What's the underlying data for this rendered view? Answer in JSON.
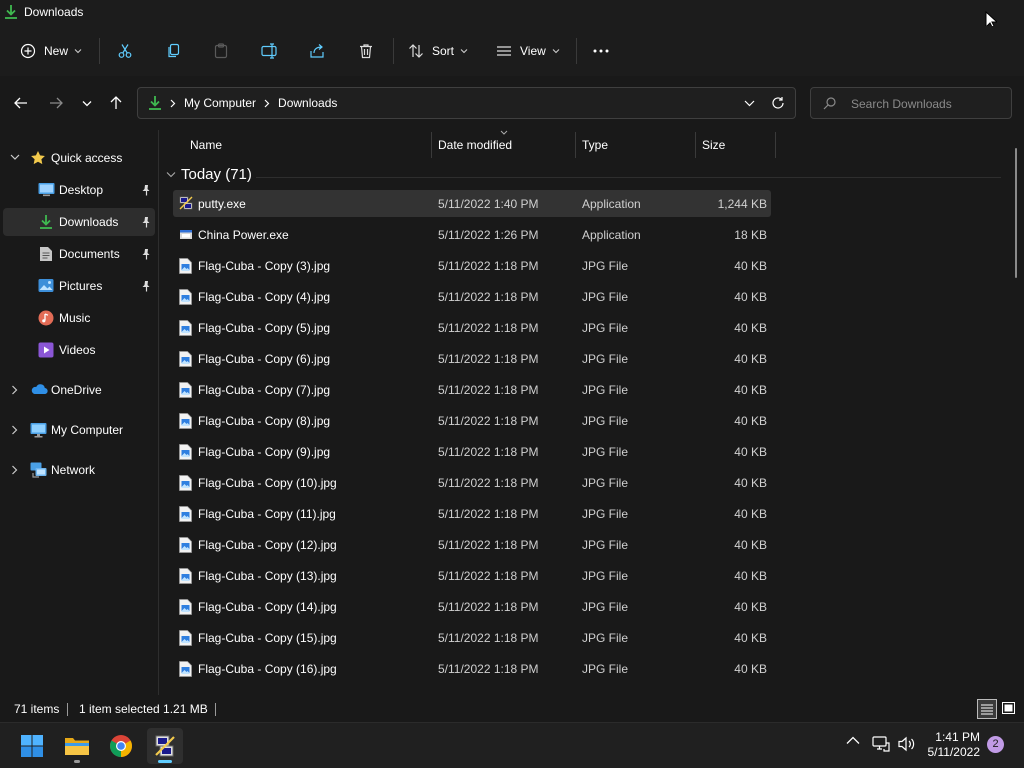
{
  "window": {
    "title": "Downloads"
  },
  "commandbar": {
    "new_label": "New",
    "sort_label": "Sort",
    "view_label": "View"
  },
  "address": {
    "crumbs": [
      "My Computer",
      "Downloads"
    ]
  },
  "search": {
    "placeholder": "Search Downloads"
  },
  "nav": {
    "items": [
      {
        "label": "Quick access",
        "icon": "star-icon"
      },
      {
        "label": "Desktop",
        "icon": "desktop-folder-icon"
      },
      {
        "label": "Downloads",
        "icon": "downloads-folder-icon"
      },
      {
        "label": "Documents",
        "icon": "documents-folder-icon"
      },
      {
        "label": "Pictures",
        "icon": "pictures-folder-icon"
      },
      {
        "label": "Music",
        "icon": "music-folder-icon"
      },
      {
        "label": "Videos",
        "icon": "videos-folder-icon"
      },
      {
        "label": "OneDrive",
        "icon": "cloud-icon"
      },
      {
        "label": "My Computer",
        "icon": "computer-icon"
      },
      {
        "label": "Network",
        "icon": "network-icon"
      }
    ]
  },
  "columns": {
    "name": "Name",
    "date": "Date modified",
    "type": "Type",
    "size": "Size"
  },
  "group": {
    "label": "Today (71)"
  },
  "files": [
    {
      "name": "putty.exe",
      "date": "5/11/2022 1:40 PM",
      "type": "Application",
      "size": "1,244 KB",
      "icon": "putty-icon"
    },
    {
      "name": "China Power.exe",
      "date": "5/11/2022 1:26 PM",
      "type": "Application",
      "size": "18 KB",
      "icon": "application-icon"
    },
    {
      "name": "Flag-Cuba - Copy (3).jpg",
      "date": "5/11/2022 1:18 PM",
      "type": "JPG File",
      "size": "40 KB",
      "icon": "image-file-icon"
    },
    {
      "name": "Flag-Cuba - Copy (4).jpg",
      "date": "5/11/2022 1:18 PM",
      "type": "JPG File",
      "size": "40 KB",
      "icon": "image-file-icon"
    },
    {
      "name": "Flag-Cuba - Copy (5).jpg",
      "date": "5/11/2022 1:18 PM",
      "type": "JPG File",
      "size": "40 KB",
      "icon": "image-file-icon"
    },
    {
      "name": "Flag-Cuba - Copy (6).jpg",
      "date": "5/11/2022 1:18 PM",
      "type": "JPG File",
      "size": "40 KB",
      "icon": "image-file-icon"
    },
    {
      "name": "Flag-Cuba - Copy (7).jpg",
      "date": "5/11/2022 1:18 PM",
      "type": "JPG File",
      "size": "40 KB",
      "icon": "image-file-icon"
    },
    {
      "name": "Flag-Cuba - Copy (8).jpg",
      "date": "5/11/2022 1:18 PM",
      "type": "JPG File",
      "size": "40 KB",
      "icon": "image-file-icon"
    },
    {
      "name": "Flag-Cuba - Copy (9).jpg",
      "date": "5/11/2022 1:18 PM",
      "type": "JPG File",
      "size": "40 KB",
      "icon": "image-file-icon"
    },
    {
      "name": "Flag-Cuba - Copy (10).jpg",
      "date": "5/11/2022 1:18 PM",
      "type": "JPG File",
      "size": "40 KB",
      "icon": "image-file-icon"
    },
    {
      "name": "Flag-Cuba - Copy (11).jpg",
      "date": "5/11/2022 1:18 PM",
      "type": "JPG File",
      "size": "40 KB",
      "icon": "image-file-icon"
    },
    {
      "name": "Flag-Cuba - Copy (12).jpg",
      "date": "5/11/2022 1:18 PM",
      "type": "JPG File",
      "size": "40 KB",
      "icon": "image-file-icon"
    },
    {
      "name": "Flag-Cuba - Copy (13).jpg",
      "date": "5/11/2022 1:18 PM",
      "type": "JPG File",
      "size": "40 KB",
      "icon": "image-file-icon"
    },
    {
      "name": "Flag-Cuba - Copy (14).jpg",
      "date": "5/11/2022 1:18 PM",
      "type": "JPG File",
      "size": "40 KB",
      "icon": "image-file-icon"
    },
    {
      "name": "Flag-Cuba - Copy (15).jpg",
      "date": "5/11/2022 1:18 PM",
      "type": "JPG File",
      "size": "40 KB",
      "icon": "image-file-icon"
    },
    {
      "name": "Flag-Cuba - Copy (16).jpg",
      "date": "5/11/2022 1:18 PM",
      "type": "JPG File",
      "size": "40 KB",
      "icon": "image-file-icon"
    }
  ],
  "status": {
    "count": "71 items",
    "selection": "1 item selected  1.21 MB"
  },
  "taskbar": {
    "time": "1:41 PM",
    "date": "5/11/2022",
    "notifications": "2"
  },
  "colors": {
    "accent": "#60cdff",
    "downloads_green": "#3fb950",
    "folder_yellow": "#f2c94c",
    "background": "#191919"
  }
}
